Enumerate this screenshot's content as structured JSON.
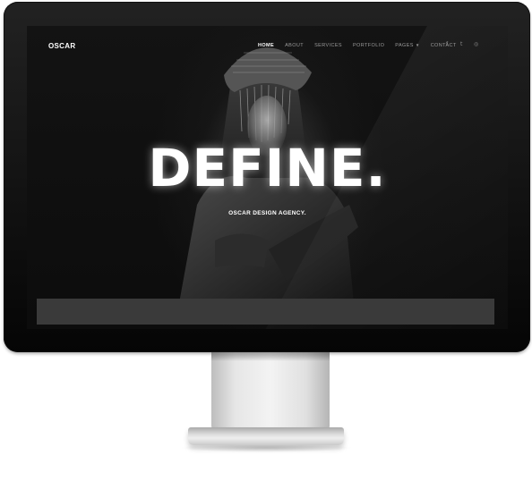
{
  "site": {
    "logo": "OSCAR"
  },
  "nav": {
    "items": [
      {
        "label": "HOME",
        "active": true
      },
      {
        "label": "ABOUT",
        "active": false
      },
      {
        "label": "SERVICES",
        "active": false
      },
      {
        "label": "PORTFOLIO",
        "active": false
      },
      {
        "label": "PAGES",
        "active": false,
        "dropdown": true
      },
      {
        "label": "CONTACT",
        "active": false
      }
    ],
    "social": [
      {
        "icon": "facebook-icon",
        "glyph": "f"
      },
      {
        "icon": "twitter-icon",
        "glyph": "t"
      },
      {
        "icon": "dribbble-icon",
        "glyph": "◎"
      }
    ]
  },
  "hero": {
    "title": "DEFINE.",
    "subtitle": "OSCAR DESIGN AGENCY."
  },
  "colors": {
    "background": "#0a0a0a",
    "text": "#ffffff",
    "nav_inactive": "#9a9a9a",
    "bar": "#3a3a3a"
  }
}
